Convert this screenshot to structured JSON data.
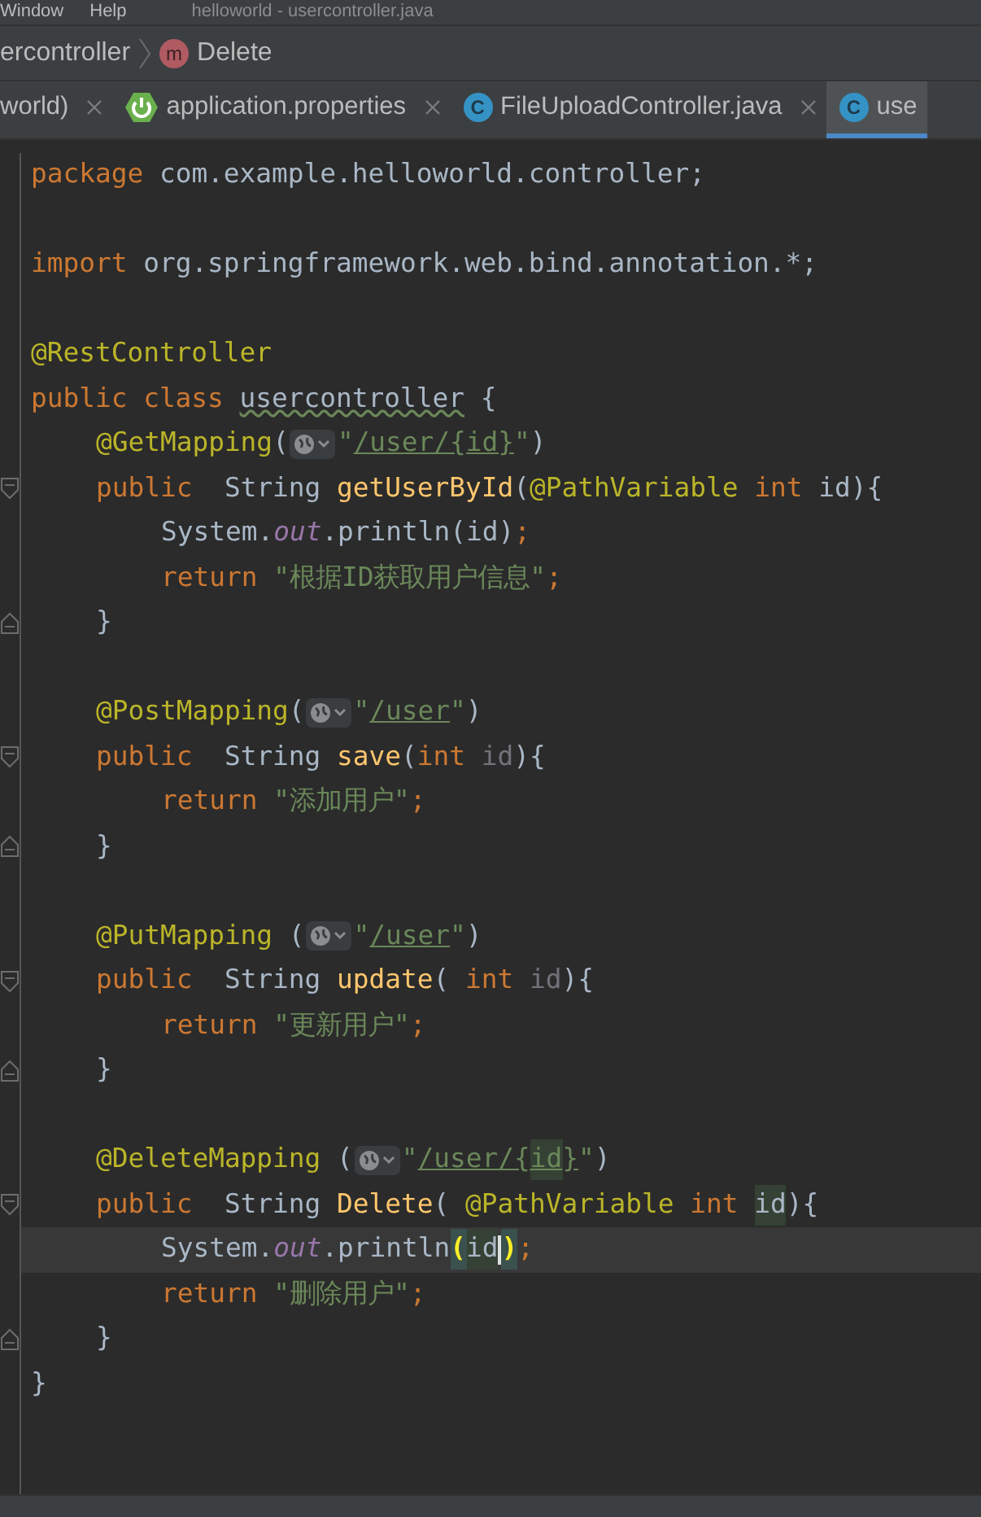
{
  "menu_bar": {
    "items": [
      "Window",
      "Help"
    ],
    "title": "helloworld - usercontroller.java"
  },
  "breadcrumb": [
    {
      "kind": "class",
      "label": "ercontroller"
    },
    {
      "kind": "method",
      "icon_letter": "m",
      "label": "Delete"
    }
  ],
  "tabs": [
    {
      "label": "world)",
      "kind": "plain",
      "selected": false
    },
    {
      "label": "application.properties",
      "kind": "spring",
      "selected": false
    },
    {
      "label": "FileUploadController.java",
      "kind": "class",
      "icon_letter": "C",
      "selected": false
    },
    {
      "label": "use",
      "kind": "class",
      "icon_letter": "C",
      "selected": true
    }
  ],
  "editor": {
    "lines": [
      {
        "current": false,
        "kind": "code",
        "tokens": [
          {
            "kind": "keyword",
            "text": "package "
          },
          {
            "kind": "plain",
            "text": "com.example.helloworld.controller;"
          }
        ]
      },
      {
        "current": false,
        "kind": "blank"
      },
      {
        "current": false,
        "kind": "code",
        "tokens": [
          {
            "kind": "keyword",
            "text": "import "
          },
          {
            "kind": "plain",
            "text": "org.springframework.web.bind.annotation.*;"
          }
        ]
      },
      {
        "current": false,
        "kind": "blank"
      },
      {
        "current": false,
        "kind": "code",
        "tokens": [
          {
            "kind": "annotation",
            "text": "@RestController"
          }
        ]
      },
      {
        "current": false,
        "kind": "code",
        "tokens": [
          {
            "kind": "keyword",
            "text": "public class "
          },
          {
            "kind": "class-warn",
            "text": "usercontroller"
          },
          {
            "kind": "plain",
            "text": " {"
          }
        ],
        "children": [
          {
            "current": false,
            "kind": "code",
            "tokens": [
              {
                "kind": "annotation",
                "text": "@GetMapping"
              },
              {
                "kind": "plain",
                "text": "("
              },
              {
                "kind": "globe"
              },
              {
                "kind": "string",
                "text": "\""
              },
              {
                "kind": "url",
                "text": "/user/{id}"
              },
              {
                "kind": "string",
                "text": "\""
              },
              {
                "kind": "plain",
                "text": ")"
              }
            ]
          },
          {
            "current": false,
            "kind": "fold-start",
            "tokens": [
              {
                "kind": "keyword",
                "text": "public  "
              },
              {
                "kind": "plain",
                "text": "String "
              },
              {
                "kind": "method",
                "text": "getUserById"
              },
              {
                "kind": "plain",
                "text": "("
              },
              {
                "kind": "annotation",
                "text": "@PathVariable "
              },
              {
                "kind": "keyword",
                "text": "int "
              },
              {
                "kind": "plain",
                "text": "id){"
              }
            ],
            "children": [
              {
                "current": false,
                "kind": "code",
                "tokens": [
                  {
                    "kind": "plain",
                    "text": "System."
                  },
                  {
                    "kind": "field",
                    "text": "out"
                  },
                  {
                    "kind": "plain",
                    "text": ".println(id)"
                  },
                  {
                    "kind": "keyword",
                    "text": ";"
                  }
                ]
              },
              {
                "current": false,
                "kind": "code",
                "tokens": [
                  {
                    "kind": "keyword",
                    "text": "return "
                  },
                  {
                    "kind": "string",
                    "text": "\"根据ID获取用户信息\""
                  },
                  {
                    "kind": "keyword",
                    "text": ";"
                  }
                ]
              }
            ]
          },
          {
            "current": false,
            "kind": "fold-end",
            "tokens": [
              {
                "kind": "plain",
                "text": "}"
              }
            ]
          },
          {
            "current": false,
            "kind": "blank"
          },
          {
            "current": false,
            "kind": "code",
            "tokens": [
              {
                "kind": "annotation",
                "text": "@PostMapping"
              },
              {
                "kind": "plain",
                "text": "("
              },
              {
                "kind": "globe"
              },
              {
                "kind": "string",
                "text": "\""
              },
              {
                "kind": "url",
                "text": "/user"
              },
              {
                "kind": "string",
                "text": "\""
              },
              {
                "kind": "plain",
                "text": ")"
              }
            ]
          },
          {
            "current": false,
            "kind": "fold-start",
            "tokens": [
              {
                "kind": "keyword",
                "text": "public  "
              },
              {
                "kind": "plain",
                "text": "String "
              },
              {
                "kind": "method",
                "text": "save"
              },
              {
                "kind": "plain",
                "text": "("
              },
              {
                "kind": "keyword",
                "text": "int "
              },
              {
                "kind": "unused",
                "text": "id"
              },
              {
                "kind": "plain",
                "text": "){"
              }
            ],
            "children": [
              {
                "current": false,
                "kind": "code",
                "tokens": [
                  {
                    "kind": "keyword",
                    "text": "return "
                  },
                  {
                    "kind": "string",
                    "text": "\"添加用户\""
                  },
                  {
                    "kind": "keyword",
                    "text": ";"
                  }
                ]
              }
            ]
          },
          {
            "current": false,
            "kind": "fold-end",
            "tokens": [
              {
                "kind": "plain",
                "text": "}"
              }
            ]
          },
          {
            "current": false,
            "kind": "blank"
          },
          {
            "current": false,
            "kind": "code",
            "tokens": [
              {
                "kind": "annotation",
                "text": "@PutMapping "
              },
              {
                "kind": "plain",
                "text": "("
              },
              {
                "kind": "globe"
              },
              {
                "kind": "string",
                "text": "\""
              },
              {
                "kind": "url",
                "text": "/user"
              },
              {
                "kind": "string",
                "text": "\""
              },
              {
                "kind": "plain",
                "text": ")"
              }
            ]
          },
          {
            "current": false,
            "kind": "fold-start",
            "tokens": [
              {
                "kind": "keyword",
                "text": "public  "
              },
              {
                "kind": "plain",
                "text": "String "
              },
              {
                "kind": "method",
                "text": "update"
              },
              {
                "kind": "plain",
                "text": "( "
              },
              {
                "kind": "keyword",
                "text": "int "
              },
              {
                "kind": "unused",
                "text": "id"
              },
              {
                "kind": "plain",
                "text": "){"
              }
            ],
            "children": [
              {
                "current": false,
                "kind": "code",
                "tokens": [
                  {
                    "kind": "keyword",
                    "text": "return "
                  },
                  {
                    "kind": "string",
                    "text": "\"更新用户\""
                  },
                  {
                    "kind": "keyword",
                    "text": ";"
                  }
                ]
              }
            ]
          },
          {
            "current": false,
            "kind": "fold-end",
            "tokens": [
              {
                "kind": "plain",
                "text": "}"
              }
            ]
          },
          {
            "current": false,
            "kind": "blank"
          },
          {
            "current": false,
            "kind": "code",
            "tokens": [
              {
                "kind": "annotation",
                "text": "@DeleteMapping "
              },
              {
                "kind": "plain",
                "text": "("
              },
              {
                "kind": "globe"
              },
              {
                "kind": "string",
                "text": "\""
              },
              {
                "kind": "url",
                "text": "/user/{"
              },
              {
                "kind": "url-hl",
                "text": "id"
              },
              {
                "kind": "url",
                "text": "}"
              },
              {
                "kind": "string",
                "text": "\""
              },
              {
                "kind": "plain",
                "text": ")"
              }
            ]
          },
          {
            "current": false,
            "kind": "fold-start",
            "tokens": [
              {
                "kind": "keyword",
                "text": "public  "
              },
              {
                "kind": "plain",
                "text": "String "
              },
              {
                "kind": "method",
                "text": "Delete"
              },
              {
                "kind": "plain",
                "text": "( "
              },
              {
                "kind": "annotation",
                "text": "@PathVariable "
              },
              {
                "kind": "keyword",
                "text": "int "
              },
              {
                "kind": "param-hl",
                "text": "id"
              },
              {
                "kind": "plain",
                "text": "){"
              }
            ],
            "children": [
              {
                "current": true,
                "kind": "code",
                "tokens": [
                  {
                    "kind": "plain",
                    "text": "System."
                  },
                  {
                    "kind": "field",
                    "text": "out"
                  },
                  {
                    "kind": "plain",
                    "text": ".println"
                  },
                  {
                    "kind": "brace-match",
                    "text": "("
                  },
                  {
                    "kind": "param-hl",
                    "text": "id"
                  },
                  {
                    "kind": "caret"
                  },
                  {
                    "kind": "brace-match",
                    "text": ")"
                  },
                  {
                    "kind": "keyword",
                    "text": ";"
                  }
                ]
              },
              {
                "current": false,
                "kind": "code",
                "tokens": [
                  {
                    "kind": "keyword",
                    "text": "return "
                  },
                  {
                    "kind": "string",
                    "text": "\"删除用户\""
                  },
                  {
                    "kind": "keyword",
                    "text": ";"
                  }
                ]
              }
            ]
          },
          {
            "current": false,
            "kind": "fold-end",
            "tokens": [
              {
                "kind": "plain",
                "text": "}"
              }
            ]
          }
        ]
      },
      {
        "current": false,
        "kind": "code",
        "tokens": [
          {
            "kind": "plain",
            "text": "}"
          }
        ]
      }
    ]
  }
}
